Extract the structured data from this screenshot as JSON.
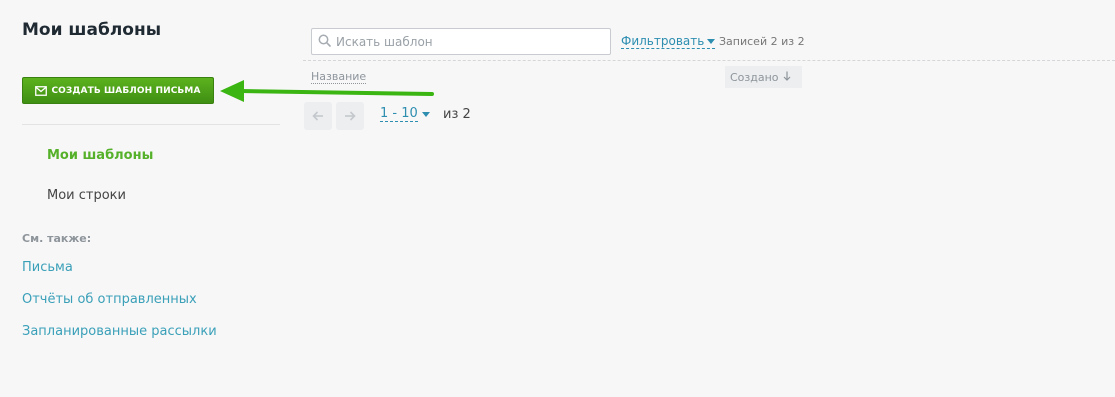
{
  "sidebar": {
    "title": "Мои шаблоны",
    "create_button": "СОЗДАТЬ ШАБЛОН ПИСЬМА",
    "nav": [
      {
        "label": "Мои шаблоны",
        "active": true
      },
      {
        "label": "Мои строки",
        "active": false
      }
    ],
    "see_also_label": "См. также:",
    "links": [
      "Письма",
      "Отчёты об отправленных",
      "Запланированные рассылки"
    ]
  },
  "toolbar": {
    "search_placeholder": "Искать шаблон",
    "filter_label": "Фильтровать",
    "records_text": "Записей 2 из 2"
  },
  "table": {
    "columns": {
      "name": "Название",
      "created": "Создано"
    }
  },
  "pagination": {
    "range": "1 - 10",
    "of_text": "из 2"
  },
  "colors": {
    "accent_green": "#56b12a",
    "link_blue": "#2d8eb0",
    "arrow_green": "#3ab512"
  },
  "icons": [
    "envelope-icon",
    "search-icon",
    "caret-down-icon",
    "sort-down-icon",
    "arrow-left-icon",
    "arrow-right-icon"
  ]
}
